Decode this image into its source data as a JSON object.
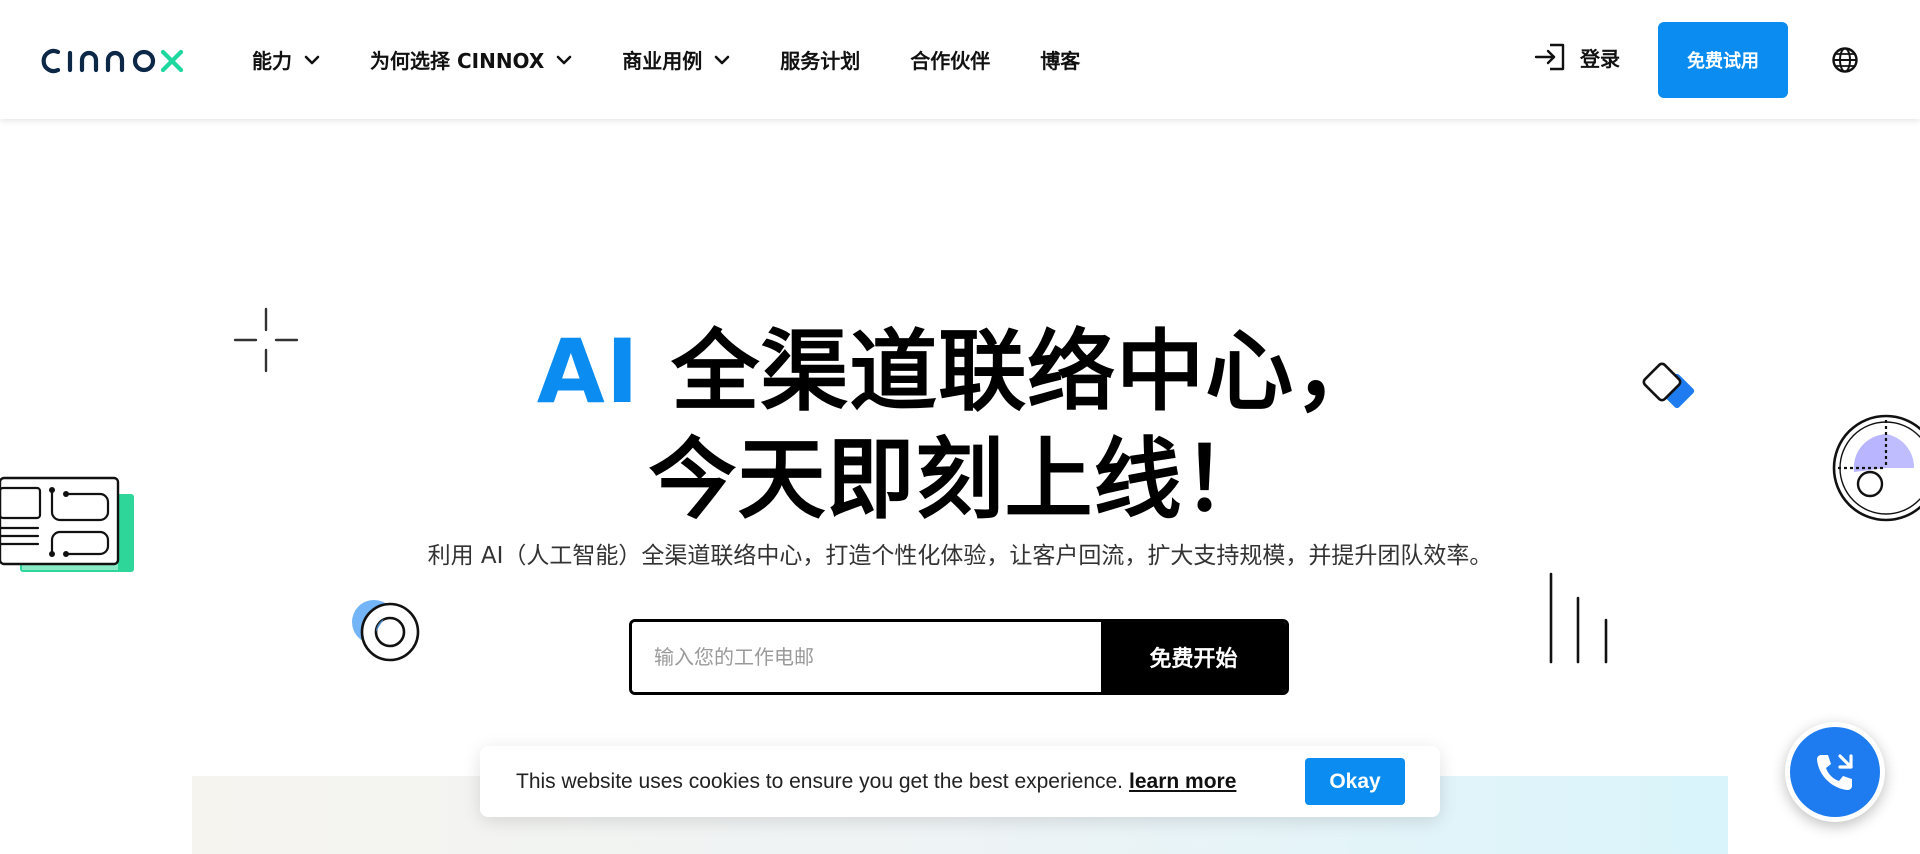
{
  "brand": {
    "logo_text": "CINNOX",
    "accent_color": "#0a8cf0",
    "logo_green": "#1fd8a0"
  },
  "nav": {
    "items": [
      {
        "label": "能力",
        "has_dropdown": true
      },
      {
        "label": "为何选择 CINNOX",
        "has_dropdown": true
      },
      {
        "label": "商业用例",
        "has_dropdown": true
      },
      {
        "label": "服务计划",
        "has_dropdown": false
      },
      {
        "label": "合作伙伴",
        "has_dropdown": false
      },
      {
        "label": "博客",
        "has_dropdown": false
      }
    ],
    "login_label": "登录",
    "login_icon": "login-arrow-icon",
    "trial_label": "免费试用",
    "globe_icon": "globe-icon"
  },
  "hero": {
    "title_accent": "AI",
    "title_line1": " 全渠道联络中心，",
    "title_line2": "今天即刻上线！",
    "subtitle": "利用 AI（人工智能）全渠道联络中心，打造个性化体验，让客户回流，扩大支持规模，并提升团队效率。",
    "email_placeholder": "输入您的工作电邮",
    "email_value": "",
    "start_label": "免费开始"
  },
  "cookie": {
    "text": "This website uses cookies to ensure you get the best experience.",
    "link_label": "learn more",
    "ok_label": "Okay"
  },
  "call_fab": {
    "icon": "phone-icon"
  }
}
